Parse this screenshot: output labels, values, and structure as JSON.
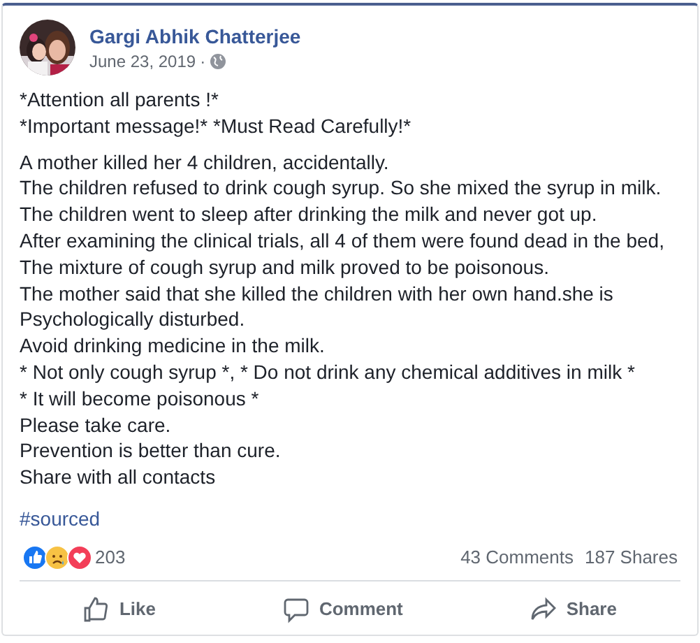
{
  "post": {
    "author": "Gargi Abhik Chatterjee",
    "date": "June 23, 2019",
    "separator": "·",
    "intro": [
      "*Attention all parents !*",
      "*Important message!* *Must Read Carefully!*"
    ],
    "body": [
      "A mother killed her 4 children, accidentally.",
      "The children refused to drink cough syrup. So she mixed the syrup in milk.",
      "The children went to sleep after drinking the milk and never got up.",
      "After examining the clinical trials, all 4 of them were found dead in the bed,",
      "The mixture of cough syrup and milk proved to be poisonous.",
      "The mother said that she killed the children with her own hand.she is",
      "Psychologically disturbed.",
      "Avoid drinking medicine in the milk.",
      "* Not only cough syrup *, * Do not drink any chemical additives in milk *",
      "* It will become poisonous *",
      "Please take care.",
      "Prevention is better than cure.",
      "Share with all contacts"
    ],
    "hashtag": "#sourced"
  },
  "reactions": {
    "kinds": [
      {
        "kind": "like"
      },
      {
        "kind": "sad"
      },
      {
        "kind": "love"
      }
    ],
    "count": "203",
    "comments": "43 Comments",
    "shares": "187 Shares"
  },
  "actions": [
    {
      "kind": "like",
      "label": "Like"
    },
    {
      "kind": "comment",
      "label": "Comment"
    },
    {
      "kind": "share",
      "label": "Share"
    }
  ]
}
